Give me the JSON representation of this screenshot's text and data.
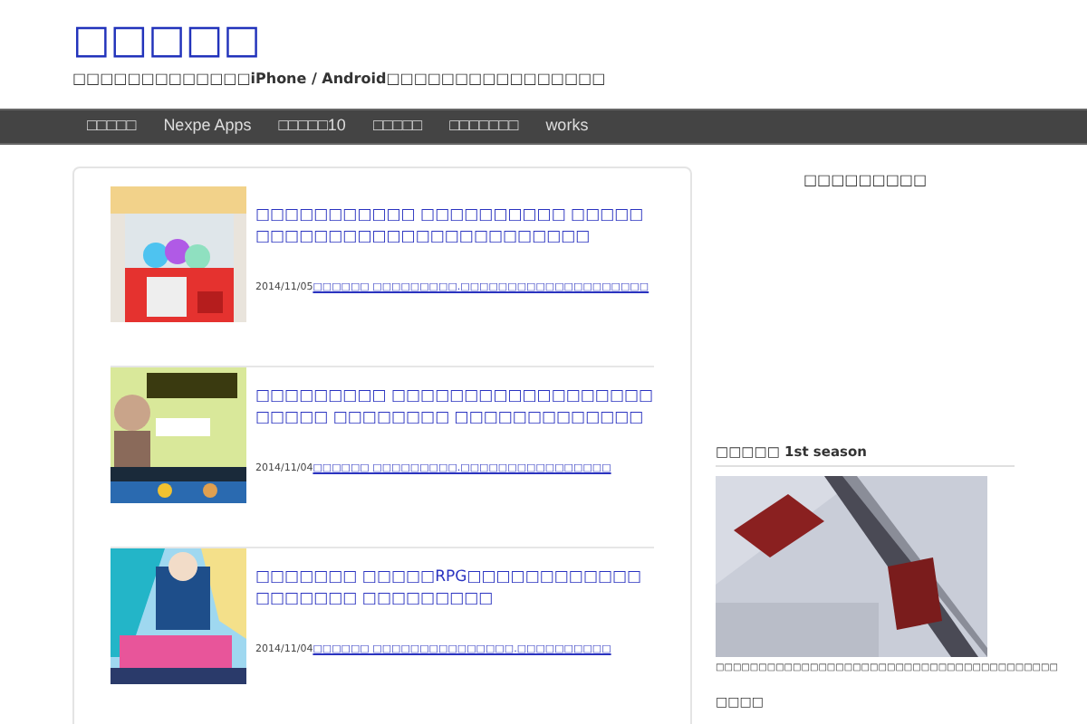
{
  "site": {
    "title": "□□□□□",
    "tagline": "□□□□□□□□□□□□□iPhone / Android□□□□□□□□□□□□□□□□"
  },
  "nav": [
    {
      "label": "□□□□□"
    },
    {
      "label": "Nexpe Apps"
    },
    {
      "label": "□□□□□10"
    },
    {
      "label": "□□□□□"
    },
    {
      "label": "□□□□□□□"
    },
    {
      "label": "works"
    }
  ],
  "posts": [
    {
      "title": "□□□□□□□□□□□ □□□□□□□□□□ □□□□□□□□□□□□□□□□□□□□□□□□□□□□",
      "date": "2014/11/05",
      "categories": "□□□□□□ □□□□□□□□□.□□□□□□□□□□□□□□□□□□□□"
    },
    {
      "title": "□□□□□□□□□ □□□□□□□□□□□□□□□□□□□□□□□ □□□□□□□□ □□□□□□□□□□□□□",
      "date": "2014/11/04",
      "categories": "□□□□□□ □□□□□□□□□.□□□□□□□□□□□□□□□□"
    },
    {
      "title": "□□□□□□□ □□□□□RPG□□□□□□□□□□□□□□□□□□□ □□□□□□□□□",
      "date": "2014/11/04",
      "categories": "□□□□□□ □□□□□□□□□□□□□□□.□□□□□□□□□□"
    }
  ],
  "sidebar": {
    "top_heading": "□□□□□□□□□",
    "widget_title": "□□□□□ 1st season",
    "caption": "□□□□□□□□□□□□□□□□□□□□□□□□□□□□□□□□□□□□□□□□",
    "footer_label": "□□□□"
  }
}
